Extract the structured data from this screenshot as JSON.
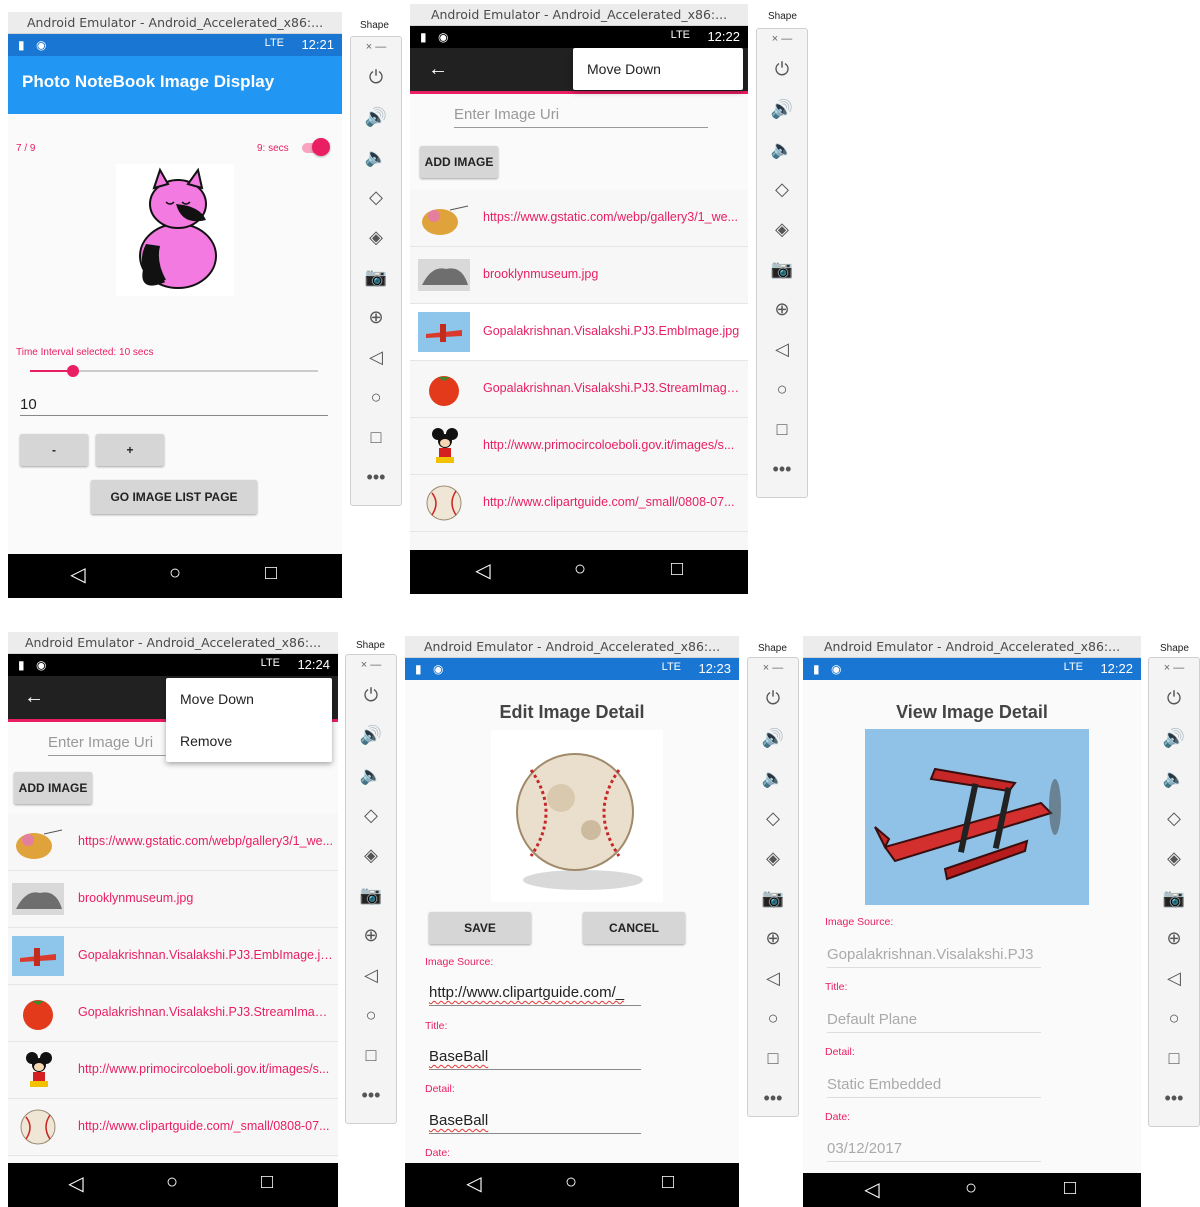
{
  "window_title": "Android Emulator - Android_Accelerated_x86:...",
  "sidebar_tab": "Shape",
  "sidebar_header": "× —",
  "sidebar_icons": [
    "⏻",
    "🔊",
    "🔈",
    "◇",
    "◈",
    "📷",
    "⊕",
    "◁",
    "○",
    "□",
    "•••"
  ],
  "nav": {
    "back": "◁",
    "home": "○",
    "recent": "□"
  },
  "status": {
    "time_1": "12:21",
    "time_2": "12:22",
    "time_3": "12:24",
    "time_4": "12:23",
    "time_5": "12:22",
    "signal": "LTE"
  },
  "colors": {
    "accent": "#e91e63",
    "appbar_blue": "#2196f3",
    "appbar_dark": "#212121",
    "statusbar_blue": "#1976d2"
  },
  "screen1": {
    "appbar_title": "Photo NoteBook Image Display",
    "counter": "7 / 9",
    "timer_label": "9: secs",
    "interval_label": "Time Interval selected: 10 secs",
    "slider_value_fraction": 0.15,
    "entry_value": "10",
    "minus_label": "-",
    "plus_label": "+",
    "go_button": "GO IMAGE LIST PAGE"
  },
  "screen2": {
    "menu_items": [
      "Move Down"
    ],
    "placeholder": "Enter Image Uri",
    "add_button": "ADD IMAGE",
    "items": [
      "https://www.gstatic.com/webp/gallery3/1_we...",
      "brooklynmuseum.jpg",
      "Gopalakrishnan.Visalakshi.PJ3.EmbImage.jpg",
      "Gopalakrishnan.Visalakshi.PJ3.StreamImage.j...",
      "http://www.primocircoloeboli.gov.it/images/s...",
      "http://www.clipartguide.com/_small/0808-07..."
    ]
  },
  "screen3": {
    "menu_items": [
      "Move Down",
      "Remove"
    ],
    "placeholder": "Enter Image Uri",
    "add_button": "ADD IMAGE",
    "items": [
      "https://www.gstatic.com/webp/gallery3/1_we...",
      "brooklynmuseum.jpg",
      "Gopalakrishnan.Visalakshi.PJ3.EmbImage.jpg",
      "Gopalakrishnan.Visalakshi.PJ3.StreamImage.j...",
      "http://www.primocircoloeboli.gov.it/images/s...",
      "http://www.clipartguide.com/_small/0808-07..."
    ]
  },
  "screen4": {
    "heading": "Edit Image Detail",
    "save": "SAVE",
    "cancel": "CANCEL",
    "source_label": "Image Source:",
    "source_value": "http://www.clipartguide.com/_",
    "title_label": "Title:",
    "title_value": "BaseBall",
    "detail_label": "Detail:",
    "detail_value": "BaseBall",
    "date_label": "Date:"
  },
  "screen5": {
    "heading": "View Image Detail",
    "source_label": "Image Source:",
    "source_value": "Gopalakrishnan.Visalakshi.PJ3",
    "title_label": "Title:",
    "title_value": "Default Plane",
    "detail_label": "Detail:",
    "detail_value": "Static Embedded",
    "date_label": "Date:",
    "date_value": "03/12/2017"
  }
}
